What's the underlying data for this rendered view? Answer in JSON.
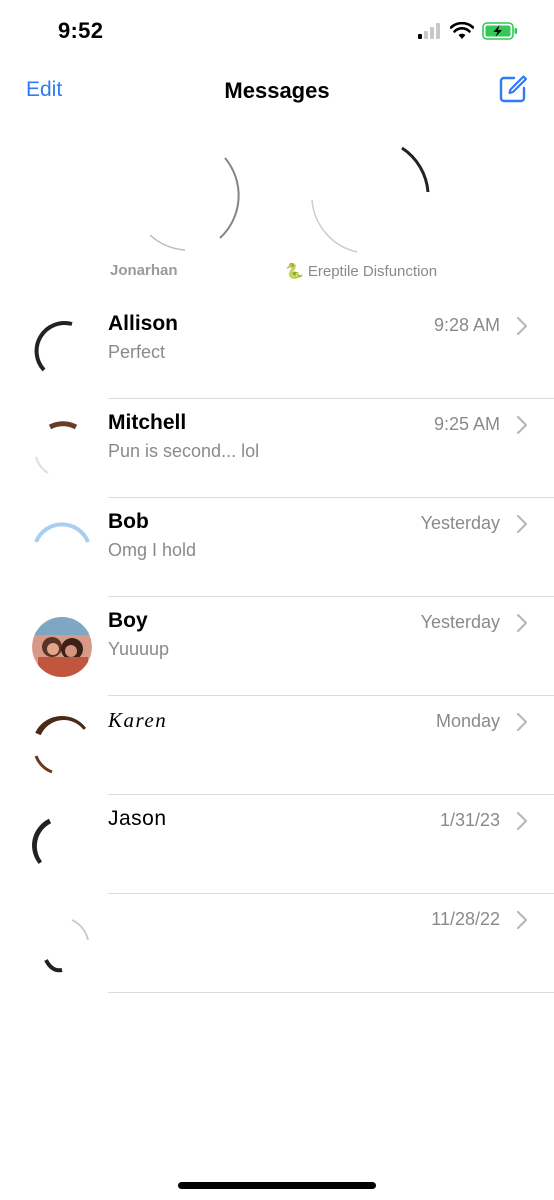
{
  "status_bar": {
    "time": "9:52",
    "icons": [
      "cellular-signal-icon",
      "wifi-icon",
      "battery-charging-icon"
    ],
    "battery_color": "#34c759"
  },
  "nav": {
    "edit_label": "Edit",
    "title": "Messages",
    "compose_icon": "compose-icon",
    "accent_color": "#2f7bf5"
  },
  "pinned": [
    {
      "label": "Jonarhan",
      "emoji": ""
    },
    {
      "label": "Ereptile Disfunction",
      "emoji": "🐍"
    }
  ],
  "conversations": [
    {
      "name": "Allison",
      "time": "9:28 AM",
      "preview": "Perfect"
    },
    {
      "name": "Mitchell",
      "time": "9:25 AM",
      "preview": "Pun is second... lol"
    },
    {
      "name": "Bob",
      "time": "Yesterday",
      "preview": "Omg I hold"
    },
    {
      "name": "Boy",
      "time": "Yesterday",
      "preview": "Yuuuup"
    },
    {
      "name": "Karen",
      "time": "Monday",
      "preview": ""
    },
    {
      "name": "Jason",
      "time": "1/31/23",
      "preview": ""
    },
    {
      "name": "",
      "time": "11/28/22",
      "preview": ""
    }
  ]
}
